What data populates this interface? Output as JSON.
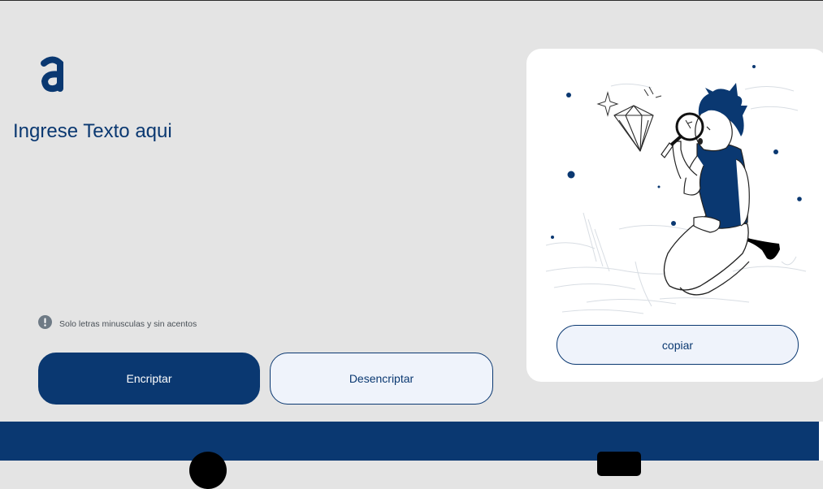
{
  "logo": {
    "icon": "alura-a-logo-icon",
    "color": "#0a3871"
  },
  "input": {
    "placeholder": "Ingrese Texto aqui",
    "value": ""
  },
  "hint": {
    "icon": "info-circle-icon",
    "text": "Solo letras minusculas y sin acentos"
  },
  "buttons": {
    "encrypt_label": "Encriptar",
    "decrypt_label": "Desencriptar"
  },
  "output_card": {
    "illustration": "person-with-magnifier-icon",
    "copy_label": "copiar"
  },
  "footer": {
    "icons": [
      "github-icon",
      "linkedin-icon"
    ]
  },
  "colors": {
    "primary": "#0a3871",
    "background": "#e4e4e4",
    "secondary_button": "#eff3fb",
    "card": "#ffffff"
  }
}
